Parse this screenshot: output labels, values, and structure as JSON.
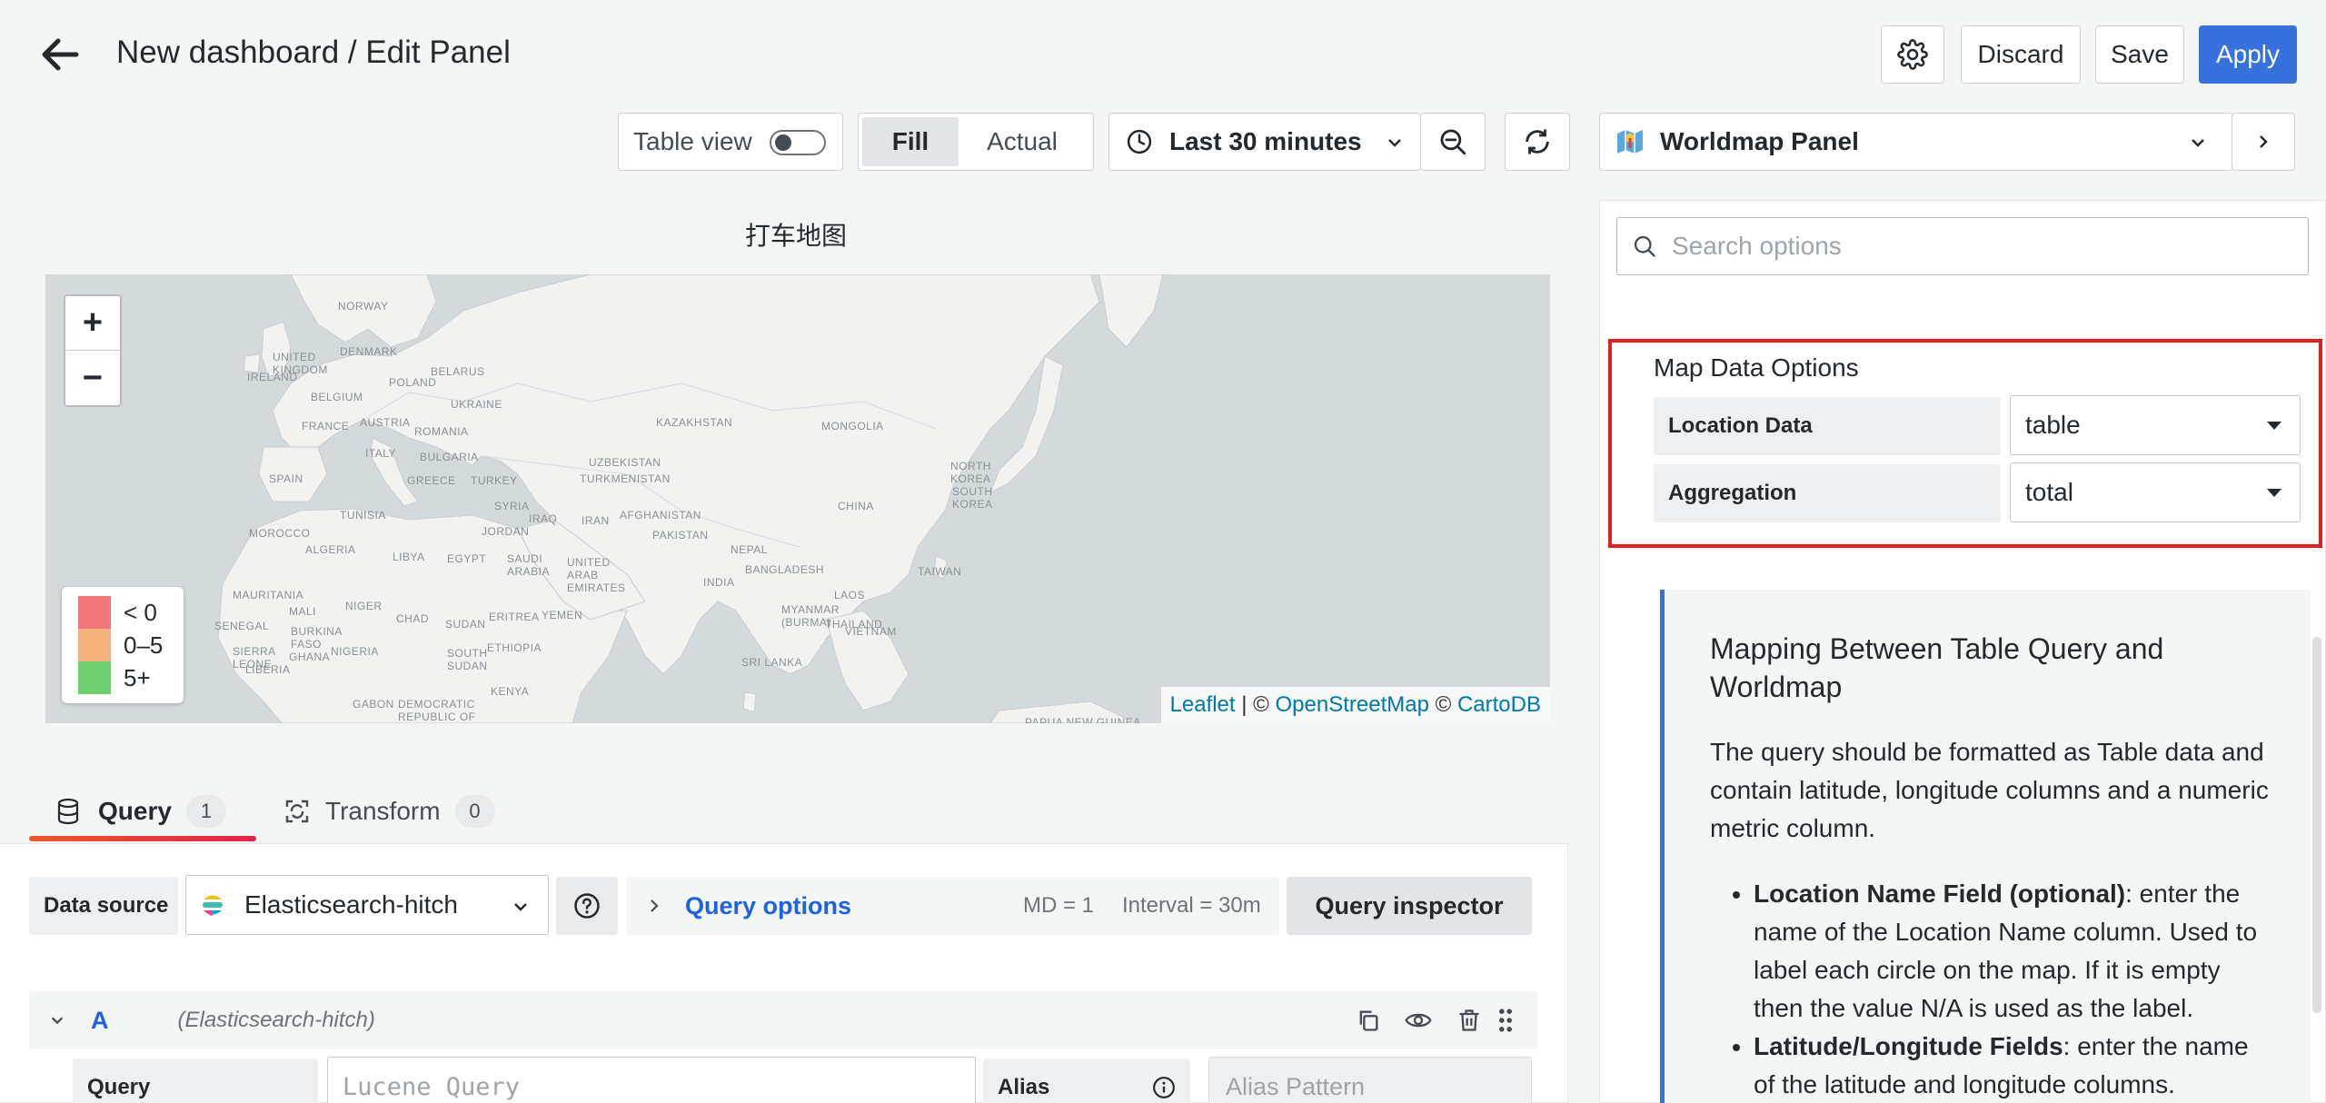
{
  "header": {
    "title": "New dashboard / Edit Panel",
    "discard_label": "Discard",
    "save_label": "Save",
    "apply_label": "Apply"
  },
  "toolbar": {
    "table_view_label": "Table view",
    "fill_label": "Fill",
    "actual_label": "Actual",
    "time_range": "Last 30 minutes",
    "visualization": "Worldmap Panel"
  },
  "panel": {
    "title": "打车地图",
    "legend": [
      "< 0",
      "0–5",
      "5+"
    ],
    "legend_colors": [
      "#f2777a",
      "#f5b27a",
      "#6fcf6f"
    ],
    "attribution": {
      "leaflet": "Leaflet",
      "sep1": " | © ",
      "osm": "OpenStreetMap",
      "sep2": " © ",
      "carto": "CartoDB"
    },
    "zoom_in": "+",
    "zoom_out": "−",
    "map_labels": {
      "norway": "NORWAY",
      "denmark": "DENMARK",
      "united_kingdom": "UNITED KINGDOM",
      "ireland": "IRELAND",
      "poland": "POLAND",
      "belarus": "BELARUS",
      "belgium": "BELGIUM",
      "ukraine": "UKRAINE",
      "france": "FRANCE",
      "austria": "AUSTRIA",
      "romania": "ROMANIA",
      "kazakhstan": "KAZAKHSTAN",
      "mongolia": "MONGOLIA",
      "spain": "SPAIN",
      "italy": "ITALY",
      "bulgaria": "BULGARIA",
      "greece": "GREECE",
      "turkey": "TURKEY",
      "uzbekistan": "UZBEKISTAN",
      "turkmenistan": "TURKMENISTAN",
      "north_korea": "NORTH KOREA",
      "south_korea": "SOUTH KOREA",
      "tunisia": "TUNISIA",
      "syria": "SYRIA",
      "iraq": "IRAQ",
      "iran": "IRAN",
      "afghanistan": "AFGHANISTAN",
      "china": "CHINA",
      "morocco": "MOROCCO",
      "jordan": "JORDAN",
      "pakistan": "PAKISTAN",
      "algeria": "ALGERIA",
      "libya": "LIBYA",
      "egypt": "EGYPT",
      "saudi_arabia": "SAUDI ARABIA",
      "uae": "UNITED ARAB EMIRATES",
      "india": "INDIA",
      "nepal": "NEPAL",
      "bangladesh": "BANGLADESH",
      "taiwan": "TAIWAN",
      "mauritania": "MAURITANIA",
      "mali": "MALI",
      "niger": "NIGER",
      "chad": "CHAD",
      "sudan": "SUDAN",
      "eritrea": "ERITREA",
      "yemen": "YEMEN",
      "myanmar": "MYANMAR (BURMA)",
      "laos": "LAOS",
      "thailand": "THAILAND",
      "vietnam": "VIETNAM",
      "senegal": "SENEGAL",
      "burkina_faso": "BURKINA FASO",
      "sierra_leone": "SIERRA LEONE",
      "liberia": "LIBERIA",
      "ghana": "GHANA",
      "nigeria": "NIGERIA",
      "south_sudan": "SOUTH SUDAN",
      "ethiopia": "ETHIOPIA",
      "sri_lanka": "SRI LANKA",
      "kenya": "KENYA",
      "gabon": "GABON",
      "drc": "DEMOCRATIC REPUBLIC OF THE CONGO",
      "papua_new_guinea": "PAPUA NEW GUINEA"
    }
  },
  "query_tabs": [
    {
      "label": "Query",
      "count": "1"
    },
    {
      "label": "Transform",
      "count": "0"
    }
  ],
  "query": {
    "datasource_label": "Data source",
    "datasource_value": "Elasticsearch-hitch",
    "query_options_label": "Query options",
    "md": "MD = 1",
    "interval": "Interval = 30m",
    "inspector_label": "Query inspector",
    "row_letter": "A",
    "row_source": "(Elasticsearch-hitch)",
    "query_label": "Query",
    "query_placeholder": "Lucene Query",
    "alias_label": "Alias",
    "alias_placeholder": "Alias Pattern"
  },
  "options": {
    "search_placeholder": "Search options",
    "section_title": "Map Data Options",
    "location_data_label": "Location Data",
    "location_data_value": "table",
    "aggregation_label": "Aggregation",
    "aggregation_value": "total",
    "help_title": "Mapping Between Table Query and Worldmap",
    "help_intro": "The query should be formatted as Table data and contain latitude, longitude columns and a numeric metric column.",
    "bullets": [
      {
        "bold": "Location Name Field (optional)",
        "text": ": enter the name of the Location Name column. Used to label each circle on the map. If it is empty then the value N/A is used as the label."
      },
      {
        "bold": "Latitude/Longitude Fields",
        "text": ": enter the name of the latitude and longitude columns."
      }
    ]
  },
  "colors": {
    "apply": "#3871dc",
    "link": "#1f62e0",
    "highlight": "#e02020",
    "tab_underline": "#f05a28"
  }
}
